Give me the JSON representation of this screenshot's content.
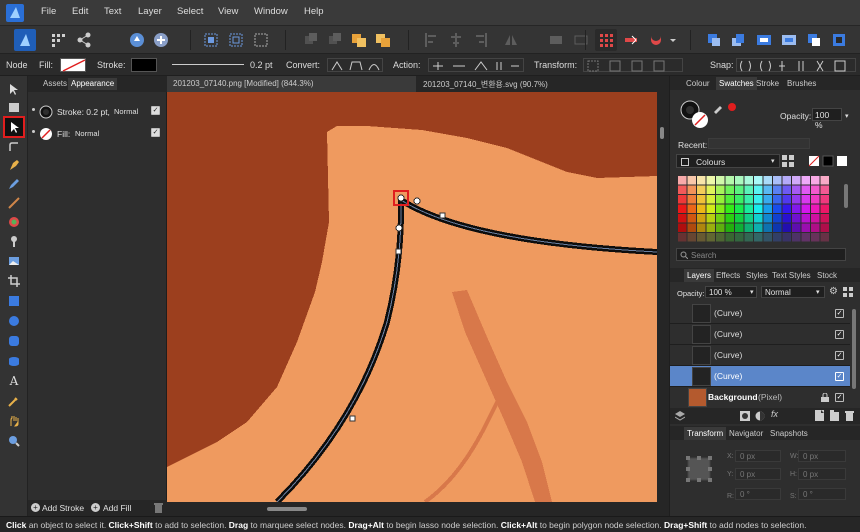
{
  "menu": [
    "File",
    "Edit",
    "Text",
    "Layer",
    "Select",
    "View",
    "Window",
    "Help"
  ],
  "context": {
    "mode": "Node",
    "fill_label": "Fill:",
    "stroke_label": "Stroke:",
    "stroke_width": "0.2 pt",
    "convert_label": "Convert:",
    "action_label": "Action:",
    "transform_label": "Transform:",
    "snap_label": "Snap:"
  },
  "left_panel": {
    "tabs": [
      "Assets",
      "Appearance"
    ],
    "stroke_row": {
      "label": "Stroke: 0.2 pt,",
      "blend": "Normal"
    },
    "fill_row": {
      "label": "Fill:",
      "blend": "Normal"
    },
    "add_stroke": "Add Stroke",
    "add_fill": "Add Fill"
  },
  "doc_tabs": [
    {
      "label": "201203_07140.png [Modified] (844.3%)"
    },
    {
      "label": "201203_07140_변환용.svg (90.7%)"
    }
  ],
  "right_top": {
    "tabs": [
      "Colour",
      "Swatches",
      "Stroke",
      "Brushes"
    ],
    "opacity_label": "Opacity:",
    "opacity_value": "100 %",
    "recent_label": "Recent:",
    "palette_name": "Colours",
    "search_placeholder": "Search"
  },
  "layers": {
    "tabs": [
      "Layers",
      "Effects",
      "Styles",
      "Text Styles",
      "Stock"
    ],
    "opacity_label": "Opacity:",
    "opacity_value": "100 %",
    "blend": "Normal",
    "rows": [
      {
        "name": "(Curve)"
      },
      {
        "name": "(Curve)"
      },
      {
        "name": "(Curve)"
      },
      {
        "name": "(Curve)"
      },
      {
        "name": "Background",
        "suffix": "(Pixel)"
      }
    ]
  },
  "transform": {
    "tabs": [
      "Transform",
      "Navigator",
      "Snapshots"
    ],
    "fields": {
      "x": "0 px",
      "y": "0 px",
      "w": "0 px",
      "h": "0 px",
      "r": "0 °",
      "s": "0 °"
    },
    "labels": {
      "x": "X:",
      "y": "Y:",
      "w": "W:",
      "h": "H:",
      "r": "R:",
      "s": "S:"
    }
  },
  "status": {
    "parts": [
      {
        "b": "Click",
        "t": " an object to select it. "
      },
      {
        "b": "Click+Shift",
        "t": " to add to selection. "
      },
      {
        "b": "Drag",
        "t": " to marquee select nodes. "
      },
      {
        "b": "Drag+Alt",
        "t": " to begin lasso node selection. "
      },
      {
        "b": "Click+Alt",
        "t": " to begin polygon node selection. "
      },
      {
        "b": "Drag+Shift",
        "t": " to add nodes to selection. "
      }
    ]
  },
  "colors": {
    "accent": "#4a78c0",
    "canvas_dark": "#9c3f1e",
    "canvas_light": "#ef9a5f",
    "canvas_mid": "#d8784a"
  }
}
